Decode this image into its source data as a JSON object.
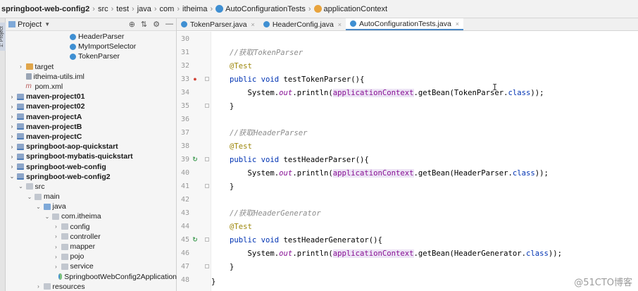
{
  "breadcrumb": {
    "items": [
      {
        "label": "springboot-web-config2",
        "bold": true
      },
      {
        "label": "src"
      },
      {
        "label": "test"
      },
      {
        "label": "java"
      },
      {
        "label": "com"
      },
      {
        "label": "itheima"
      },
      {
        "label": "AutoConfigurationTests",
        "icon": "class-icon"
      },
      {
        "label": "applicationContext",
        "icon": "field-icon"
      }
    ],
    "separator": "›"
  },
  "side_strip": {
    "label": "1: Project"
  },
  "project_panel": {
    "title": "Project",
    "dropdown": "▼",
    "tools": [
      "⊕",
      "⇅",
      "⚙",
      "—"
    ],
    "tree": [
      {
        "indent": 6,
        "arrow": "",
        "icon": "class",
        "label": "HeaderParser"
      },
      {
        "indent": 6,
        "arrow": "",
        "icon": "class",
        "label": "MyImportSelector"
      },
      {
        "indent": 6,
        "arrow": "",
        "icon": "class",
        "label": "TokenParser"
      },
      {
        "indent": 1,
        "arrow": "›",
        "icon": "folder-orange",
        "label": "target"
      },
      {
        "indent": 1,
        "arrow": "",
        "icon": "iml",
        "label": "itheima-utils.iml"
      },
      {
        "indent": 1,
        "arrow": "",
        "icon": "maven",
        "label": "pom.xml"
      },
      {
        "indent": 0,
        "arrow": "›",
        "icon": "module",
        "label": "maven-project01",
        "bold": true
      },
      {
        "indent": 0,
        "arrow": "›",
        "icon": "module",
        "label": "maven-project02",
        "bold": true
      },
      {
        "indent": 0,
        "arrow": "›",
        "icon": "module",
        "label": "maven-projectA",
        "bold": true
      },
      {
        "indent": 0,
        "arrow": "›",
        "icon": "module",
        "label": "maven-projectB",
        "bold": true
      },
      {
        "indent": 0,
        "arrow": "›",
        "icon": "module",
        "label": "maven-projectC",
        "bold": true
      },
      {
        "indent": 0,
        "arrow": "›",
        "icon": "module",
        "label": "springboot-aop-quickstart",
        "bold": true
      },
      {
        "indent": 0,
        "arrow": "›",
        "icon": "module",
        "label": "springboot-mybatis-quickstart",
        "bold": true
      },
      {
        "indent": 0,
        "arrow": "›",
        "icon": "module",
        "label": "springboot-web-config",
        "bold": true
      },
      {
        "indent": 0,
        "arrow": "⌄",
        "icon": "module",
        "label": "springboot-web-config2",
        "bold": true
      },
      {
        "indent": 1,
        "arrow": "⌄",
        "icon": "folder",
        "label": "src"
      },
      {
        "indent": 2,
        "arrow": "⌄",
        "icon": "folder",
        "label": "main"
      },
      {
        "indent": 3,
        "arrow": "⌄",
        "icon": "folder-blue",
        "label": "java"
      },
      {
        "indent": 4,
        "arrow": "⌄",
        "icon": "folder",
        "label": "com.itheima"
      },
      {
        "indent": 5,
        "arrow": "›",
        "icon": "folder",
        "label": "config"
      },
      {
        "indent": 5,
        "arrow": "›",
        "icon": "folder",
        "label": "controller"
      },
      {
        "indent": 5,
        "arrow": "›",
        "icon": "folder",
        "label": "mapper"
      },
      {
        "indent": 5,
        "arrow": "›",
        "icon": "folder",
        "label": "pojo"
      },
      {
        "indent": 5,
        "arrow": "›",
        "icon": "folder",
        "label": "service"
      },
      {
        "indent": 5,
        "arrow": "",
        "icon": "cls-app",
        "label": "SpringbootWebConfig2Application"
      },
      {
        "indent": 3,
        "arrow": "›",
        "icon": "folder",
        "label": "resources"
      }
    ]
  },
  "tabs": [
    {
      "label": "TokenParser.java",
      "active": false
    },
    {
      "label": "HeaderConfig.java",
      "active": false
    },
    {
      "label": "AutoConfigurationTests.java",
      "active": true
    }
  ],
  "tab_close": "×",
  "editor": {
    "lines": [
      {
        "n": "30",
        "parts": [],
        "fold": false,
        "gutter": ""
      },
      {
        "n": "31",
        "parts": [
          {
            "c": "cm",
            "t": "//获取TokenParser"
          }
        ],
        "fold": false,
        "gutter": ""
      },
      {
        "n": "32",
        "parts": [
          {
            "c": "an",
            "t": "@Test"
          }
        ],
        "fold": false,
        "gutter": ""
      },
      {
        "n": "33",
        "parts": [
          {
            "c": "k",
            "t": "public void "
          },
          {
            "c": "",
            "t": "testTokenParser(){"
          }
        ],
        "fold": true,
        "gutter": "bp"
      },
      {
        "n": "34",
        "parts": [
          {
            "c": "",
            "t": "    System."
          },
          {
            "c": "fld",
            "t": "out"
          },
          {
            "c": "",
            "t": ".println("
          },
          {
            "c": "hl",
            "t": "applicationContext"
          },
          {
            "c": "",
            "t": ".getBean(TokenParser."
          },
          {
            "c": "k",
            "t": "class"
          },
          {
            "c": "",
            "t": "));"
          }
        ],
        "fold": false,
        "gutter": ""
      },
      {
        "n": "35",
        "parts": [
          {
            "c": "",
            "t": "}"
          }
        ],
        "fold": true,
        "gutter": ""
      },
      {
        "n": "36",
        "parts": [],
        "fold": false,
        "gutter": ""
      },
      {
        "n": "37",
        "parts": [
          {
            "c": "cm",
            "t": "//获取HeaderParser"
          }
        ],
        "fold": false,
        "gutter": ""
      },
      {
        "n": "38",
        "parts": [
          {
            "c": "an",
            "t": "@Test"
          }
        ],
        "fold": false,
        "gutter": ""
      },
      {
        "n": "39",
        "parts": [
          {
            "c": "k",
            "t": "public void "
          },
          {
            "c": "",
            "t": "testHeaderParser(){"
          }
        ],
        "fold": true,
        "gutter": "run"
      },
      {
        "n": "40",
        "parts": [
          {
            "c": "",
            "t": "    System."
          },
          {
            "c": "fld",
            "t": "out"
          },
          {
            "c": "",
            "t": ".println("
          },
          {
            "c": "hl",
            "t": "applicationContext"
          },
          {
            "c": "",
            "t": ".getBean(HeaderParser."
          },
          {
            "c": "k",
            "t": "class"
          },
          {
            "c": "",
            "t": "));"
          }
        ],
        "fold": false,
        "gutter": ""
      },
      {
        "n": "41",
        "parts": [
          {
            "c": "",
            "t": "}"
          }
        ],
        "fold": true,
        "gutter": ""
      },
      {
        "n": "42",
        "parts": [],
        "fold": false,
        "gutter": ""
      },
      {
        "n": "43",
        "parts": [
          {
            "c": "cm",
            "t": "//获取HeaderGenerator"
          }
        ],
        "fold": false,
        "gutter": ""
      },
      {
        "n": "44",
        "parts": [
          {
            "c": "an",
            "t": "@Test"
          }
        ],
        "fold": false,
        "gutter": ""
      },
      {
        "n": "45",
        "parts": [
          {
            "c": "k",
            "t": "public void "
          },
          {
            "c": "",
            "t": "testHeaderGenerator(){"
          }
        ],
        "fold": true,
        "gutter": "run"
      },
      {
        "n": "46",
        "parts": [
          {
            "c": "",
            "t": "    System."
          },
          {
            "c": "fld",
            "t": "out"
          },
          {
            "c": "",
            "t": ".println("
          },
          {
            "c": "hl",
            "t": "applicationContext"
          },
          {
            "c": "",
            "t": ".getBean(HeaderGenerator."
          },
          {
            "c": "k",
            "t": "class"
          },
          {
            "c": "",
            "t": "));"
          }
        ],
        "fold": false,
        "gutter": ""
      },
      {
        "n": "47",
        "parts": [
          {
            "c": "",
            "t": "}"
          }
        ],
        "fold": true,
        "gutter": ""
      },
      {
        "n": "48",
        "parts": [],
        "fold": false,
        "gutter": ""
      }
    ],
    "closing_brace": "}",
    "text_cursor": "I"
  },
  "watermark": "@51CTO博客",
  "colors": {
    "keyword": "#0033b3",
    "comment": "#8c8c8c",
    "annotation": "#9e880d",
    "field": "#871094",
    "tab_accent": "#4a88c7"
  }
}
